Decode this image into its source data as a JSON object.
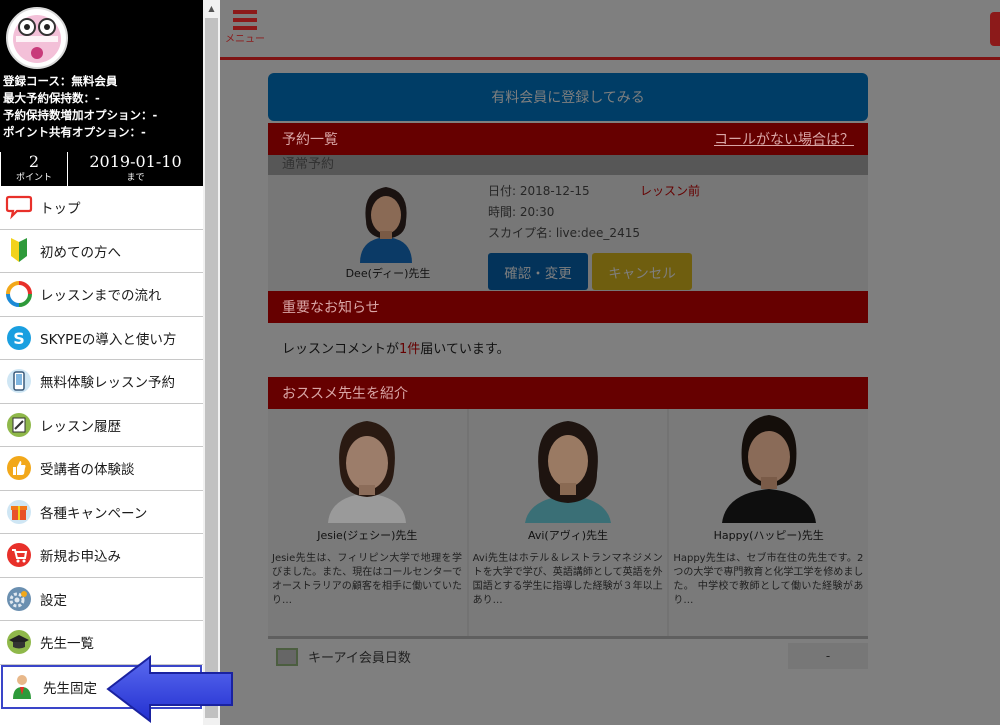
{
  "sidebar": {
    "info": [
      "登録コース：無料会員",
      "最大予約保持数：-",
      "予約保持数増加オプション：-",
      "ポイント共有オプション：-"
    ],
    "points_value": "2",
    "points_label": "ポイント",
    "expiry_date": "2019-01-10",
    "expiry_label": "まで",
    "menu": [
      {
        "label": "トップ",
        "icon": "speech-bubble-icon"
      },
      {
        "label": "初めての方へ",
        "icon": "beginner-mark-icon"
      },
      {
        "label": "レッスンまでの流れ",
        "icon": "cycle-arrows-icon"
      },
      {
        "label": "SKYPEの導入と使い方",
        "icon": "skype-icon"
      },
      {
        "label": "無料体験レッスン予約",
        "icon": "phone-icon"
      },
      {
        "label": "レッスン履歴",
        "icon": "notebook-icon"
      },
      {
        "label": "受講者の体験談",
        "icon": "thumbs-up-icon"
      },
      {
        "label": "各種キャンペーン",
        "icon": "gift-icon"
      },
      {
        "label": "新規お申込み",
        "icon": "cart-icon"
      },
      {
        "label": "設定",
        "icon": "gear-icon"
      },
      {
        "label": "先生一覧",
        "icon": "graduation-cap-icon"
      },
      {
        "label": "先生固定",
        "icon": "teacher-person-icon"
      }
    ]
  },
  "header": {
    "menu_label": "メニュー"
  },
  "main": {
    "premium_button": "有料会員に登録してみる",
    "reservations": {
      "title": "予約一覧",
      "no_call_link": "コールがない場合は？",
      "subheading": "通常予約",
      "teacher_name": "Dee(ディー)先生",
      "date_line": "日付: 2018-12-15",
      "time_line": "時間: 20:30",
      "skype_line": "スカイプ名: live:dee_2415",
      "status": "レッスン前",
      "confirm_button": "確認・変更",
      "cancel_button": "キャンセル"
    },
    "notice": {
      "title": "重要なお知らせ",
      "text_before": "レッスンコメントが",
      "count": "1件",
      "text_after": "届いています。"
    },
    "recommended": {
      "title": "おススメ先生を紹介",
      "teachers": [
        {
          "name": "Jesie(ジェシー)先生",
          "desc": "Jesie先生は、フィリピン大学で地理を学びました。また、現在はコールセンターでオーストラリアの顧客を相手に働いていたり…"
        },
        {
          "name": "Avi(アヴィ)先生",
          "desc": "Avi先生はホテル＆レストランマネジメントを大学で学び、英語講師として英語を外国語とする学生に指導した経験が３年以上あり…"
        },
        {
          "name": "Happy(ハッピー)先生",
          "desc": "Happy先生は、セブ市在住の先生です。2つの大学で専門教育と化学工学を修めました。 中学校で教師として働いた経験があり…"
        }
      ]
    },
    "footer": {
      "label": "キーアイ会員日数",
      "value": "-"
    }
  }
}
